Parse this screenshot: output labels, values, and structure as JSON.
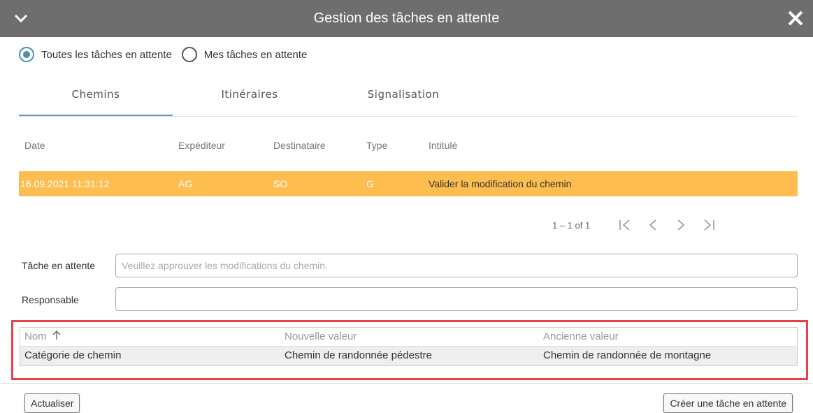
{
  "dialog": {
    "title": "Gestion des tâches en attente"
  },
  "filter": {
    "options": [
      {
        "label": "Toutes les tâches en attente",
        "checked": true
      },
      {
        "label": "Mes tâches en attente",
        "checked": false
      }
    ]
  },
  "tabs": [
    {
      "label": "Chemins",
      "active": true
    },
    {
      "label": "Itinéraires",
      "active": false
    },
    {
      "label": "Signalisation",
      "active": false
    }
  ],
  "grid": {
    "columns": [
      "Date",
      "Expéditeur",
      "Destinataire",
      "Type",
      "Intitulé"
    ],
    "rows": [
      {
        "date": "16.09.2021 11:31:12",
        "sender": "AG",
        "recipient": "SO",
        "type": "G",
        "title": "Valider la modification du chemin",
        "selected": true,
        "highlight_color": "#fdbd4f"
      }
    ]
  },
  "pager": {
    "range": "1 – 1 of 1"
  },
  "form": {
    "task_label": "Tâche en attente",
    "task_placeholder": "Veuillez approuver les modifications du chemin.",
    "responsible_label": "Responsable",
    "responsible_value": ""
  },
  "changes": {
    "columns": [
      "Nom",
      "Nouvelle valeur",
      "Ancienne valeur"
    ],
    "sort_icon": "arrow-up-icon",
    "rows": [
      {
        "name": "Catégorie de chemin",
        "new": "Chemin de randonnée pédestre",
        "old": "Chemin de randonnée de montagne"
      }
    ],
    "highlight_border_color": "#e8414a"
  },
  "footer": {
    "refresh_label": "Actualiser",
    "create_label": "Créer une tâche en attente"
  }
}
